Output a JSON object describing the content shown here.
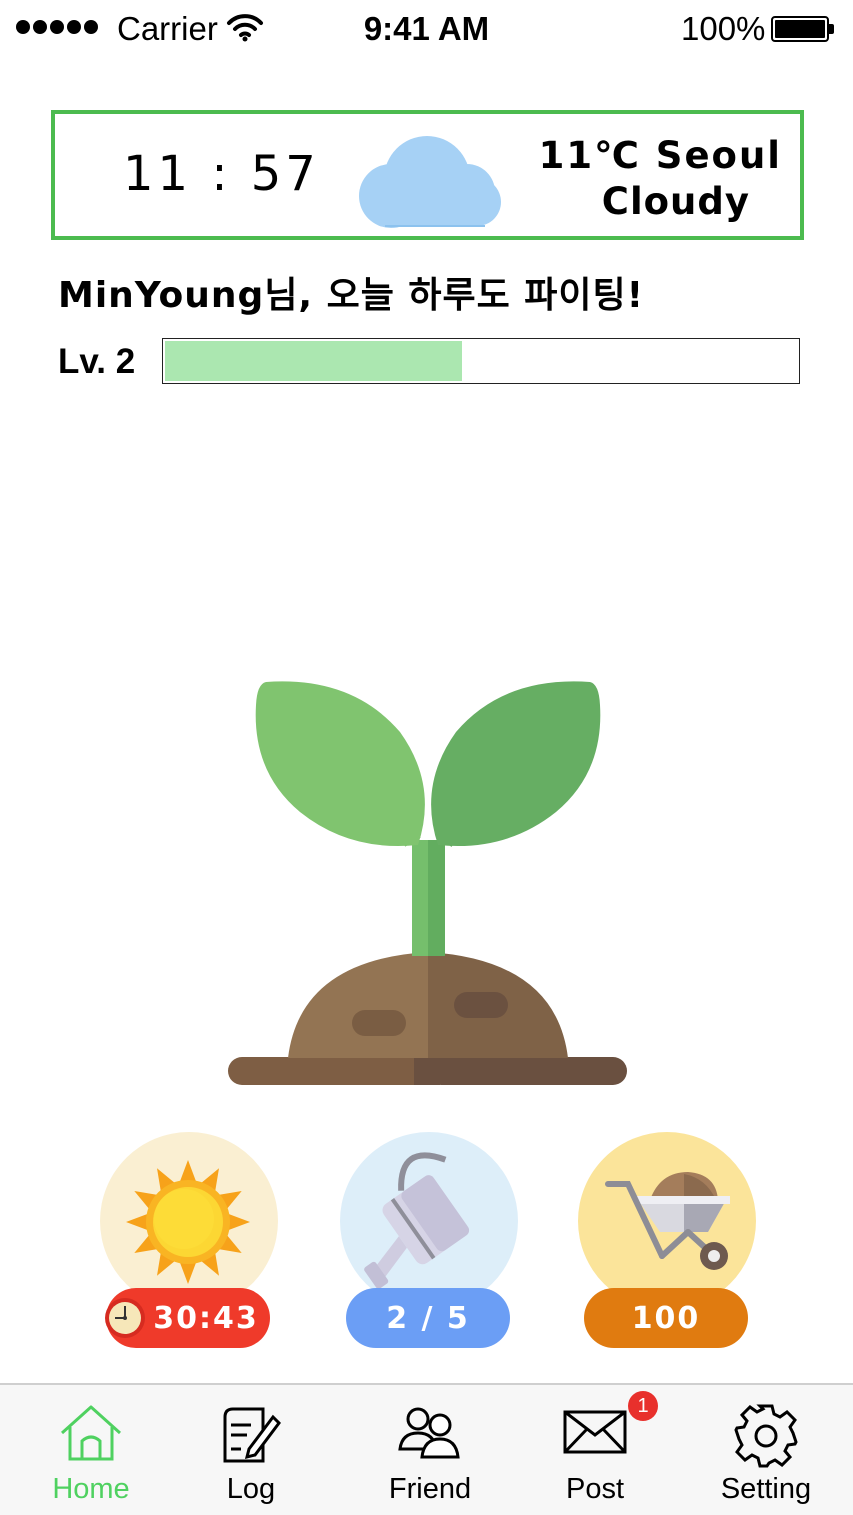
{
  "status_bar": {
    "carrier": "Carrier",
    "time": "9:41 AM",
    "battery": "100%"
  },
  "weather": {
    "clock": "11 : 57",
    "temperature": "11℃ Seoul",
    "condition": "Cloudy",
    "icon": "cloud-icon"
  },
  "greeting": "MinYoung님, 오늘 하루도 파이팅!",
  "level": {
    "label": "Lv. 2",
    "progress": 0.47
  },
  "actions": [
    {
      "icon": "sun-icon",
      "label": "30:43",
      "color": "#ef3a2a",
      "disc_color": "#faefd2",
      "has_timer": true
    },
    {
      "icon": "watering-can-icon",
      "label": "2 / 5",
      "color": "#6b9ef5",
      "disc_color": "#ddeef9"
    },
    {
      "icon": "wheelbarrow-icon",
      "label": "100",
      "color": "#e07b10",
      "disc_color": "#fbe49a"
    }
  ],
  "tabs": [
    {
      "label": "Home",
      "icon": "home-icon",
      "active": true
    },
    {
      "label": "Log",
      "icon": "log-icon"
    },
    {
      "label": "Friend",
      "icon": "friend-icon"
    },
    {
      "label": "Post",
      "icon": "mail-icon",
      "badge": "1"
    },
    {
      "label": "Setting",
      "icon": "gear-icon"
    }
  ],
  "colors": {
    "accent": "#4fd160",
    "weather_border": "#4cbb4f",
    "xp_fill": "#abe7b0"
  }
}
